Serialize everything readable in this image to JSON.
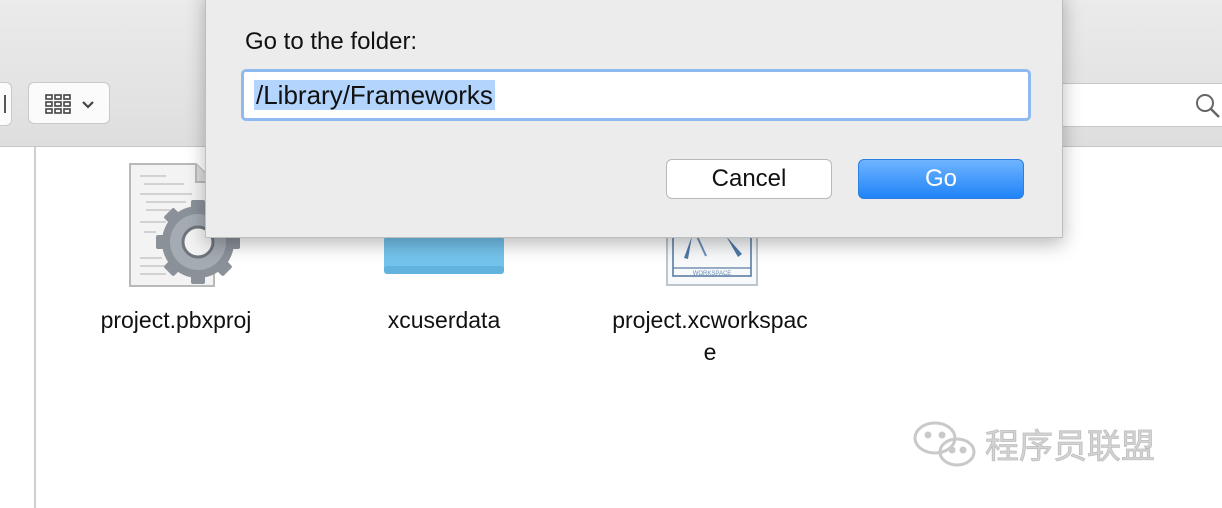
{
  "dialog": {
    "title": "Go to the folder:",
    "path_value": "/Library/Frameworks",
    "cancel_label": "Cancel",
    "go_label": "Go"
  },
  "files": [
    {
      "name": "project.pbxproj",
      "icon": "pbxproj-document-icon"
    },
    {
      "name": "xcuserdata",
      "icon": "folder-icon"
    },
    {
      "name_line1": "project.xcworkspac",
      "name_line2": "e",
      "icon": "xcworkspace-icon",
      "badge": "WORKSPACE"
    }
  ],
  "toolbar": {
    "view_button_icon": "icon-view-grid-icon",
    "search_icon": "search-icon"
  },
  "watermark": {
    "text": "程序员联盟"
  },
  "colors": {
    "go_button": "#1f83f7",
    "input_focus_ring": "#8fbaf0",
    "selection": "#b3d4fc",
    "folder": "#74c3ec"
  }
}
